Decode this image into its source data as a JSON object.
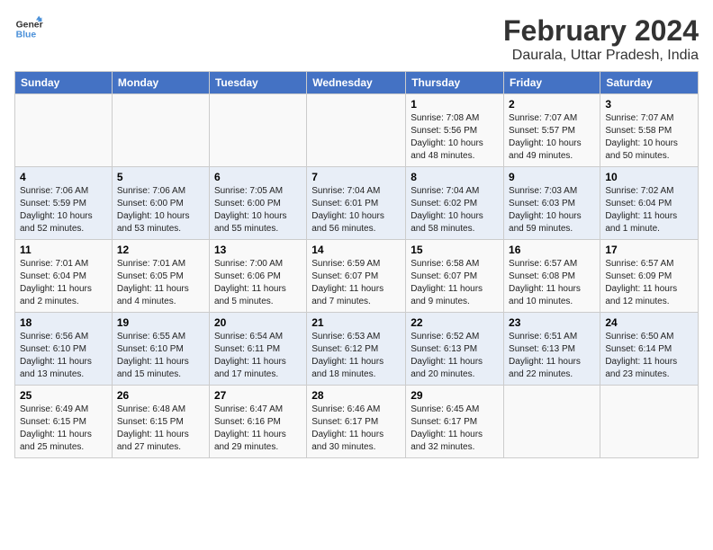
{
  "header": {
    "logo_line1": "General",
    "logo_line2": "Blue",
    "month": "February 2024",
    "location": "Daurala, Uttar Pradesh, India"
  },
  "weekdays": [
    "Sunday",
    "Monday",
    "Tuesday",
    "Wednesday",
    "Thursday",
    "Friday",
    "Saturday"
  ],
  "weeks": [
    [
      {
        "day": "",
        "info": ""
      },
      {
        "day": "",
        "info": ""
      },
      {
        "day": "",
        "info": ""
      },
      {
        "day": "",
        "info": ""
      },
      {
        "day": "1",
        "info": "Sunrise: 7:08 AM\nSunset: 5:56 PM\nDaylight: 10 hours\nand 48 minutes."
      },
      {
        "day": "2",
        "info": "Sunrise: 7:07 AM\nSunset: 5:57 PM\nDaylight: 10 hours\nand 49 minutes."
      },
      {
        "day": "3",
        "info": "Sunrise: 7:07 AM\nSunset: 5:58 PM\nDaylight: 10 hours\nand 50 minutes."
      }
    ],
    [
      {
        "day": "4",
        "info": "Sunrise: 7:06 AM\nSunset: 5:59 PM\nDaylight: 10 hours\nand 52 minutes."
      },
      {
        "day": "5",
        "info": "Sunrise: 7:06 AM\nSunset: 6:00 PM\nDaylight: 10 hours\nand 53 minutes."
      },
      {
        "day": "6",
        "info": "Sunrise: 7:05 AM\nSunset: 6:00 PM\nDaylight: 10 hours\nand 55 minutes."
      },
      {
        "day": "7",
        "info": "Sunrise: 7:04 AM\nSunset: 6:01 PM\nDaylight: 10 hours\nand 56 minutes."
      },
      {
        "day": "8",
        "info": "Sunrise: 7:04 AM\nSunset: 6:02 PM\nDaylight: 10 hours\nand 58 minutes."
      },
      {
        "day": "9",
        "info": "Sunrise: 7:03 AM\nSunset: 6:03 PM\nDaylight: 10 hours\nand 59 minutes."
      },
      {
        "day": "10",
        "info": "Sunrise: 7:02 AM\nSunset: 6:04 PM\nDaylight: 11 hours\nand 1 minute."
      }
    ],
    [
      {
        "day": "11",
        "info": "Sunrise: 7:01 AM\nSunset: 6:04 PM\nDaylight: 11 hours\nand 2 minutes."
      },
      {
        "day": "12",
        "info": "Sunrise: 7:01 AM\nSunset: 6:05 PM\nDaylight: 11 hours\nand 4 minutes."
      },
      {
        "day": "13",
        "info": "Sunrise: 7:00 AM\nSunset: 6:06 PM\nDaylight: 11 hours\nand 5 minutes."
      },
      {
        "day": "14",
        "info": "Sunrise: 6:59 AM\nSunset: 6:07 PM\nDaylight: 11 hours\nand 7 minutes."
      },
      {
        "day": "15",
        "info": "Sunrise: 6:58 AM\nSunset: 6:07 PM\nDaylight: 11 hours\nand 9 minutes."
      },
      {
        "day": "16",
        "info": "Sunrise: 6:57 AM\nSunset: 6:08 PM\nDaylight: 11 hours\nand 10 minutes."
      },
      {
        "day": "17",
        "info": "Sunrise: 6:57 AM\nSunset: 6:09 PM\nDaylight: 11 hours\nand 12 minutes."
      }
    ],
    [
      {
        "day": "18",
        "info": "Sunrise: 6:56 AM\nSunset: 6:10 PM\nDaylight: 11 hours\nand 13 minutes."
      },
      {
        "day": "19",
        "info": "Sunrise: 6:55 AM\nSunset: 6:10 PM\nDaylight: 11 hours\nand 15 minutes."
      },
      {
        "day": "20",
        "info": "Sunrise: 6:54 AM\nSunset: 6:11 PM\nDaylight: 11 hours\nand 17 minutes."
      },
      {
        "day": "21",
        "info": "Sunrise: 6:53 AM\nSunset: 6:12 PM\nDaylight: 11 hours\nand 18 minutes."
      },
      {
        "day": "22",
        "info": "Sunrise: 6:52 AM\nSunset: 6:13 PM\nDaylight: 11 hours\nand 20 minutes."
      },
      {
        "day": "23",
        "info": "Sunrise: 6:51 AM\nSunset: 6:13 PM\nDaylight: 11 hours\nand 22 minutes."
      },
      {
        "day": "24",
        "info": "Sunrise: 6:50 AM\nSunset: 6:14 PM\nDaylight: 11 hours\nand 23 minutes."
      }
    ],
    [
      {
        "day": "25",
        "info": "Sunrise: 6:49 AM\nSunset: 6:15 PM\nDaylight: 11 hours\nand 25 minutes."
      },
      {
        "day": "26",
        "info": "Sunrise: 6:48 AM\nSunset: 6:15 PM\nDaylight: 11 hours\nand 27 minutes."
      },
      {
        "day": "27",
        "info": "Sunrise: 6:47 AM\nSunset: 6:16 PM\nDaylight: 11 hours\nand 29 minutes."
      },
      {
        "day": "28",
        "info": "Sunrise: 6:46 AM\nSunset: 6:17 PM\nDaylight: 11 hours\nand 30 minutes."
      },
      {
        "day": "29",
        "info": "Sunrise: 6:45 AM\nSunset: 6:17 PM\nDaylight: 11 hours\nand 32 minutes."
      },
      {
        "day": "",
        "info": ""
      },
      {
        "day": "",
        "info": ""
      }
    ]
  ]
}
